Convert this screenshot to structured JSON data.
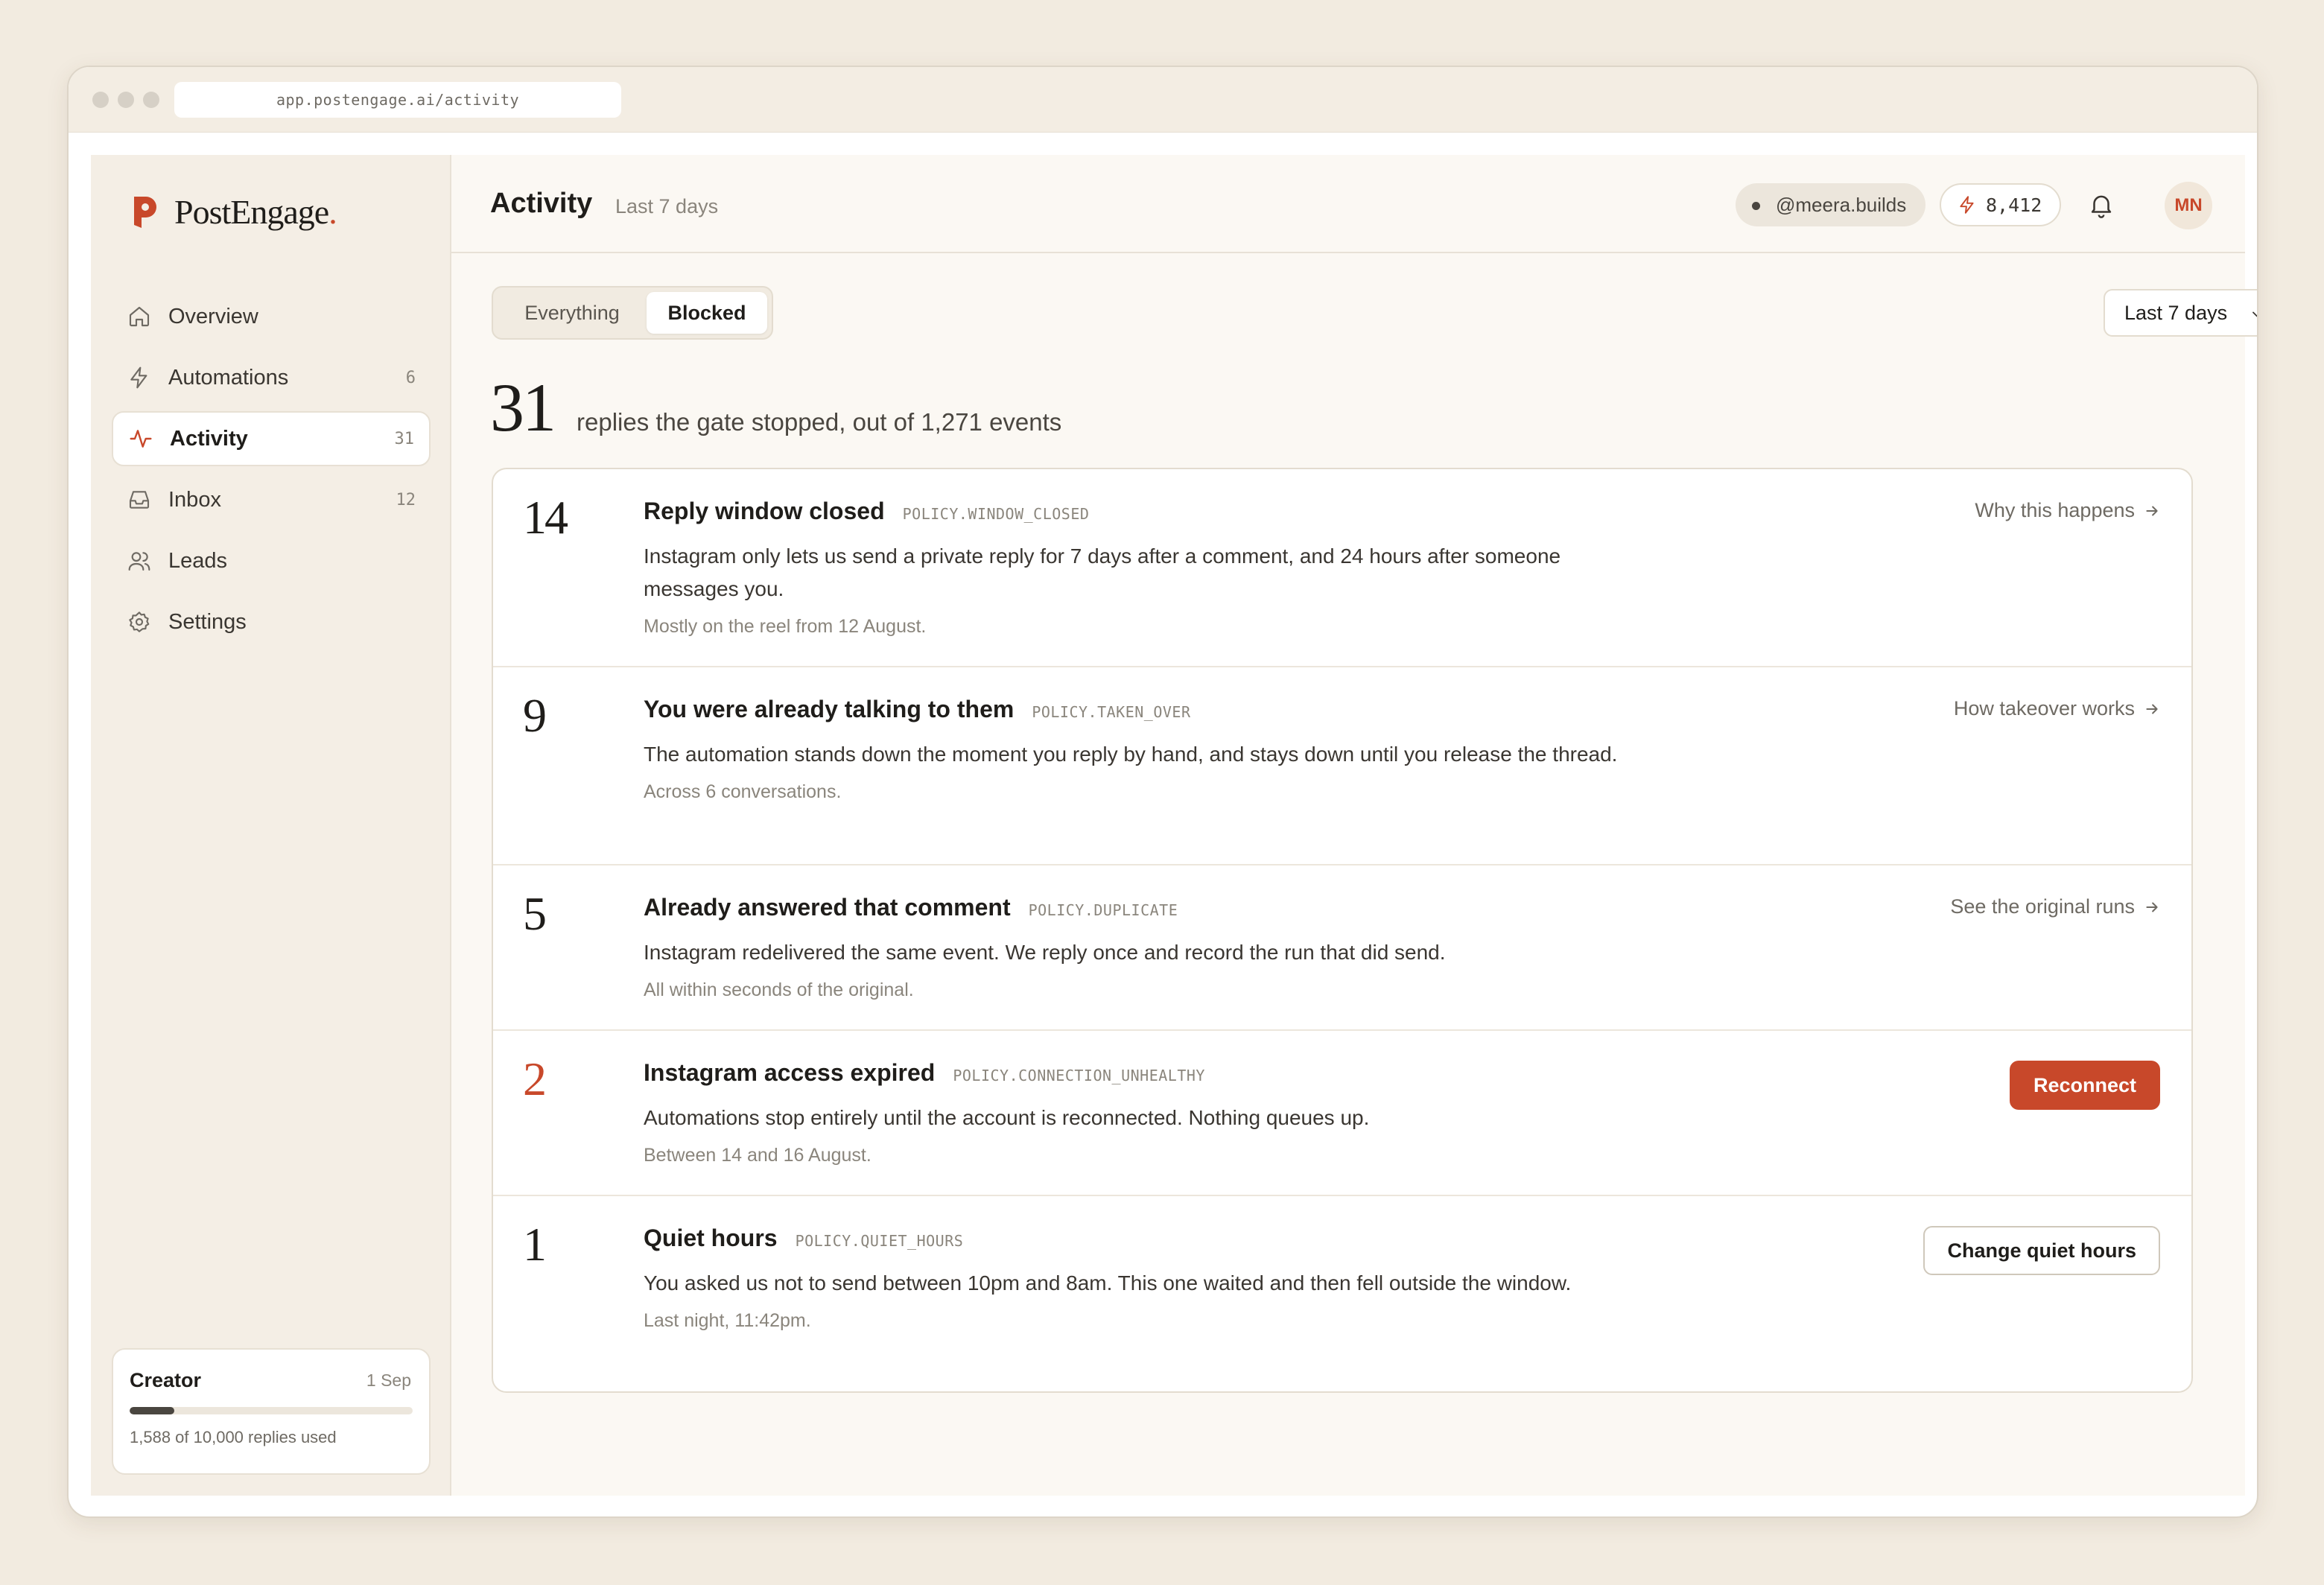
{
  "browser": {
    "url": "app.postengage.ai/activity"
  },
  "brand": {
    "name": "PostEngage",
    "dot": ".",
    "accent": "#c8482a"
  },
  "sidebar": {
    "items": [
      {
        "label": "Overview",
        "icon": "home-icon",
        "count": ""
      },
      {
        "label": "Automations",
        "icon": "lightning-icon",
        "count": "6"
      },
      {
        "label": "Activity",
        "icon": "activity-icon",
        "count": "31"
      },
      {
        "label": "Inbox",
        "icon": "inbox-icon",
        "count": "12"
      },
      {
        "label": "Leads",
        "icon": "users-icon",
        "count": ""
      },
      {
        "label": "Settings",
        "icon": "gear-icon",
        "count": ""
      }
    ],
    "plan": {
      "name": "Creator",
      "date": "1 Sep",
      "usage": "1,588 of 10,000 replies used",
      "used_fraction": 0.1588
    }
  },
  "header": {
    "title": "Activity",
    "subtitle": "Last 7 days",
    "handle": "@meera.builds",
    "credits": "8,412",
    "avatar": "MN"
  },
  "filters": {
    "tabs": [
      {
        "label": "Everything",
        "active": false
      },
      {
        "label": "Blocked",
        "active": true
      }
    ],
    "range": "Last 7 days"
  },
  "summary": {
    "count": "31",
    "text": "replies the gate stopped, out of 1,271 events"
  },
  "reasons": [
    {
      "count": "14",
      "title": "Reply window closed",
      "code": "POLICY.WINDOW_CLOSED",
      "description": "Instagram only lets us send a private reply for 7 days after a comment, and 24 hours after someone messages you.",
      "meta": "Mostly on the reel from 12 August.",
      "action": "Why this happens",
      "action_type": "link"
    },
    {
      "count": "9",
      "title": "You were already talking to them",
      "code": "POLICY.TAKEN_OVER",
      "description": "The automation stands down the moment you reply by hand, and stays down until you release the thread.",
      "meta": "Across 6 conversations.",
      "action": "How takeover works",
      "action_type": "link"
    },
    {
      "count": "5",
      "title": "Already answered that comment",
      "code": "POLICY.DUPLICATE",
      "description": "Instagram redelivered the same event. We reply once and record the run that did send.",
      "meta": "All within seconds of the original.",
      "action": "See the original runs",
      "action_type": "link"
    },
    {
      "count": "2",
      "title": "Instagram access expired",
      "code": "POLICY.CONNECTION_UNHEALTHY",
      "description": "Automations stop entirely until the account is reconnected. Nothing queues up.",
      "meta": "Between 14 and 16 August.",
      "action": "Reconnect",
      "action_type": "primary"
    },
    {
      "count": "1",
      "title": "Quiet hours",
      "code": "POLICY.QUIET_HOURS",
      "description": "You asked us not to send between 10pm and 8am. This one waited and then fell outside the window.",
      "meta": "Last night, 11:42pm.",
      "action": "Change quiet hours",
      "action_type": "secondary"
    }
  ]
}
